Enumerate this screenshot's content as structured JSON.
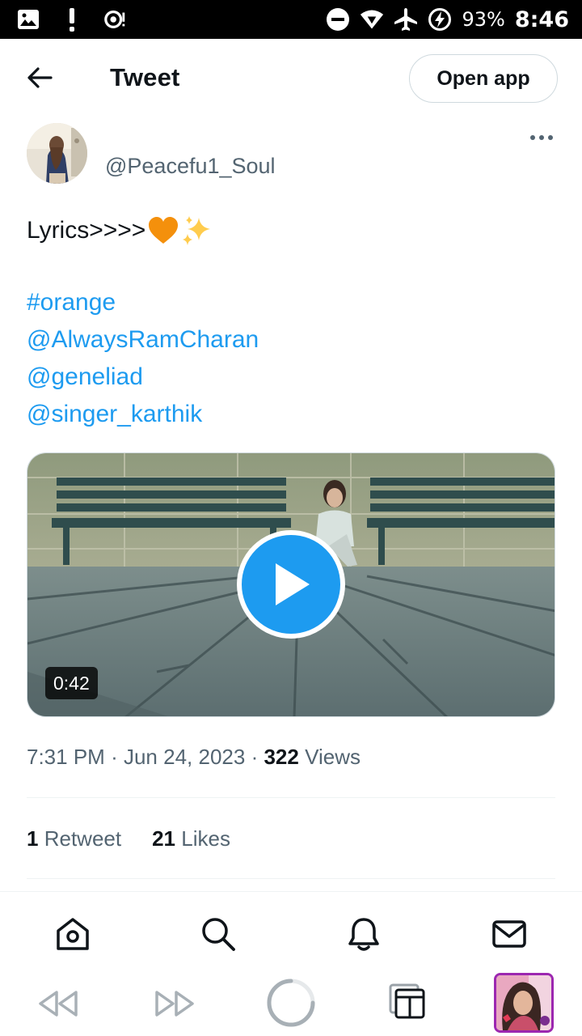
{
  "status_bar": {
    "battery": "93%",
    "time": "8:46",
    "icons": [
      "gallery-icon",
      "alert-icon",
      "camera-sync-icon",
      "dnd-icon",
      "wifi-icon",
      "airplane-icon",
      "battery-charging-icon"
    ]
  },
  "header": {
    "title": "Tweet",
    "open_app_label": "Open app"
  },
  "author": {
    "handle": "@Peacefu1_Soul"
  },
  "tweet": {
    "text": "Lyrics>>>>",
    "emojis": [
      "orange-heart",
      "sparkles"
    ],
    "links": [
      "#orange",
      "@AlwaysRamCharan",
      "@geneliad",
      "@singer_karthik"
    ]
  },
  "video": {
    "duration": "0:42"
  },
  "meta": {
    "time": "7:31 PM",
    "date": "Jun 24, 2023",
    "views_count": "322",
    "views_label": "Views",
    "separator": "·"
  },
  "stats": {
    "retweets_count": "1",
    "retweets_label": "Retweet",
    "likes_count": "21",
    "likes_label": "Likes"
  },
  "bottom_nav": {
    "items": [
      "home-icon",
      "search-icon",
      "notifications-icon",
      "messages-icon"
    ]
  },
  "browser_bar": {
    "items": [
      "rewind-icon",
      "fast-forward-icon",
      "reload-icon",
      "tabs-icon",
      "tab-thumbnail"
    ]
  },
  "colors": {
    "link": "#1d9bf0",
    "text": "#0f1419",
    "muted": "#536471",
    "border": "#cfd9de",
    "tab_border": "#9c27b0"
  }
}
